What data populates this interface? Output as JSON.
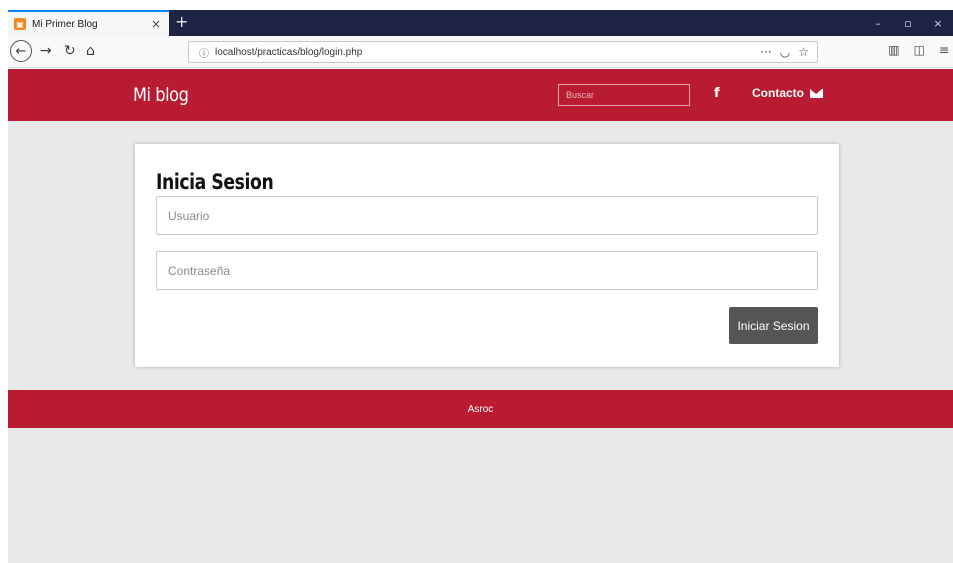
{
  "browser": {
    "tab_title": "Mi Primer Blog",
    "tab_close": "×",
    "new_tab": "+",
    "url": "localhost/practicas/blog/login.php",
    "url_more": "···",
    "win_minimize": "–",
    "win_restore": "▫",
    "win_close": "×"
  },
  "header": {
    "logo": "Mi blog",
    "search_placeholder": "Buscar",
    "facebook_label": "f",
    "contact_label": "Contacto"
  },
  "login": {
    "title": "Inicia Sesion",
    "user_placeholder": "Usuario",
    "password_placeholder": "Contraseña",
    "submit_label": "Iniciar Sesion"
  },
  "footer": {
    "text": "Asroc"
  },
  "colors": {
    "brand": "#b91c32",
    "page_bg": "#e9e9e9",
    "button_bg": "#555555"
  }
}
